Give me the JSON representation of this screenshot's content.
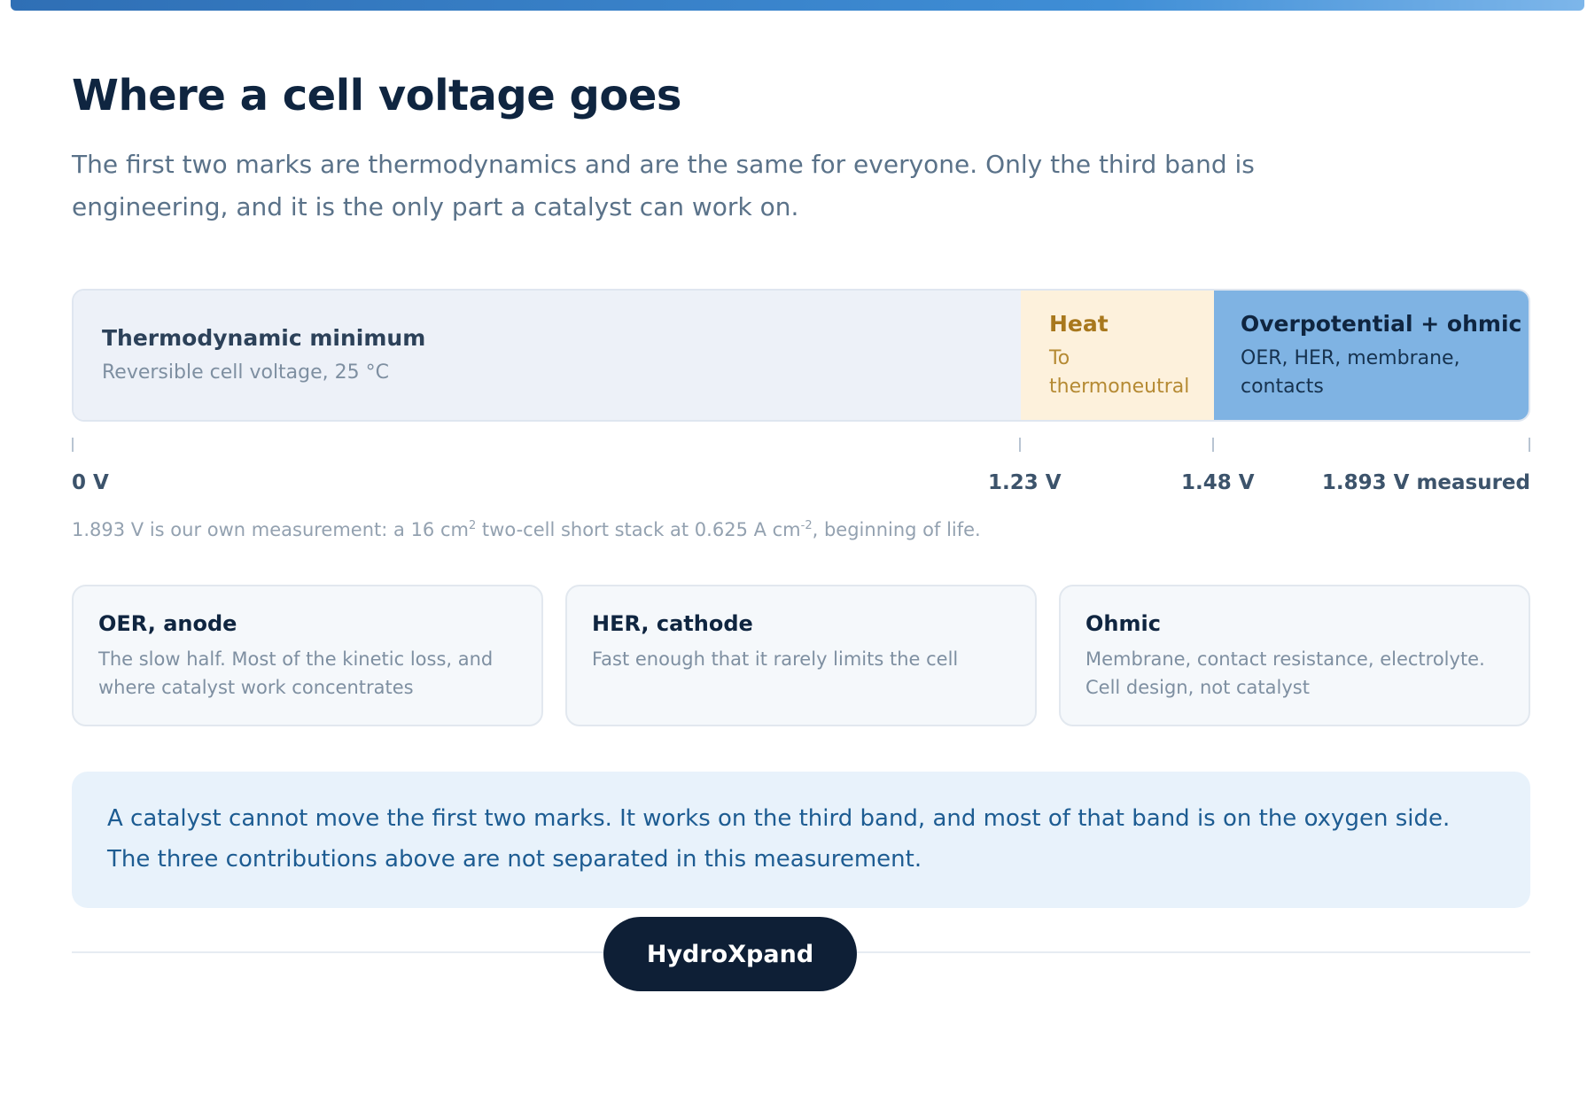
{
  "header": {
    "title": "Where a cell voltage goes",
    "subtitle": "The first two marks are thermodynamics and are the same for everyone. Only the third band is engineering, and it is the only part a catalyst can work on."
  },
  "voltage_bar": {
    "segments": [
      {
        "title": "Thermodynamic minimum",
        "subtitle": "Reversible cell voltage, 25 °C",
        "from_v": 0,
        "to_v": 1.23
      },
      {
        "title": "Heat",
        "subtitle": "To thermoneutral",
        "from_v": 1.23,
        "to_v": 1.48
      },
      {
        "title": "Overpotential + ohmic",
        "subtitle": "OER, HER, membrane, contacts",
        "from_v": 1.48,
        "to_v": 1.893
      }
    ],
    "ticks": [
      "0 V",
      "1.23 V",
      "1.48 V",
      "1.893 V measured"
    ],
    "colors": {
      "thermo": "#edf1f8",
      "heat": "#fdf1dc",
      "over": "#7fb3e3"
    }
  },
  "note": {
    "part1": "1.893 V is our own measurement: a 16 cm",
    "sup1": "2",
    "part2": " two-cell short stack at 0.625 A cm",
    "sup2": "-2",
    "part3": ", beginning of life."
  },
  "cards": [
    {
      "title": "OER, anode",
      "text": "The slow half. Most of the kinetic loss, and where catalyst work concentrates"
    },
    {
      "title": "HER, cathode",
      "text": "Fast enough that it rarely limits the cell"
    },
    {
      "title": "Ohmic",
      "text": "Membrane, contact resistance, electrolyte. Cell design, not catalyst"
    }
  ],
  "callout": {
    "text": "A catalyst cannot move the first two marks. It works on the third band, and most of that band is on the oxygen side. The three contributions above are not separated in this measurement."
  },
  "footer": {
    "brand_button": "HydroXpand"
  }
}
